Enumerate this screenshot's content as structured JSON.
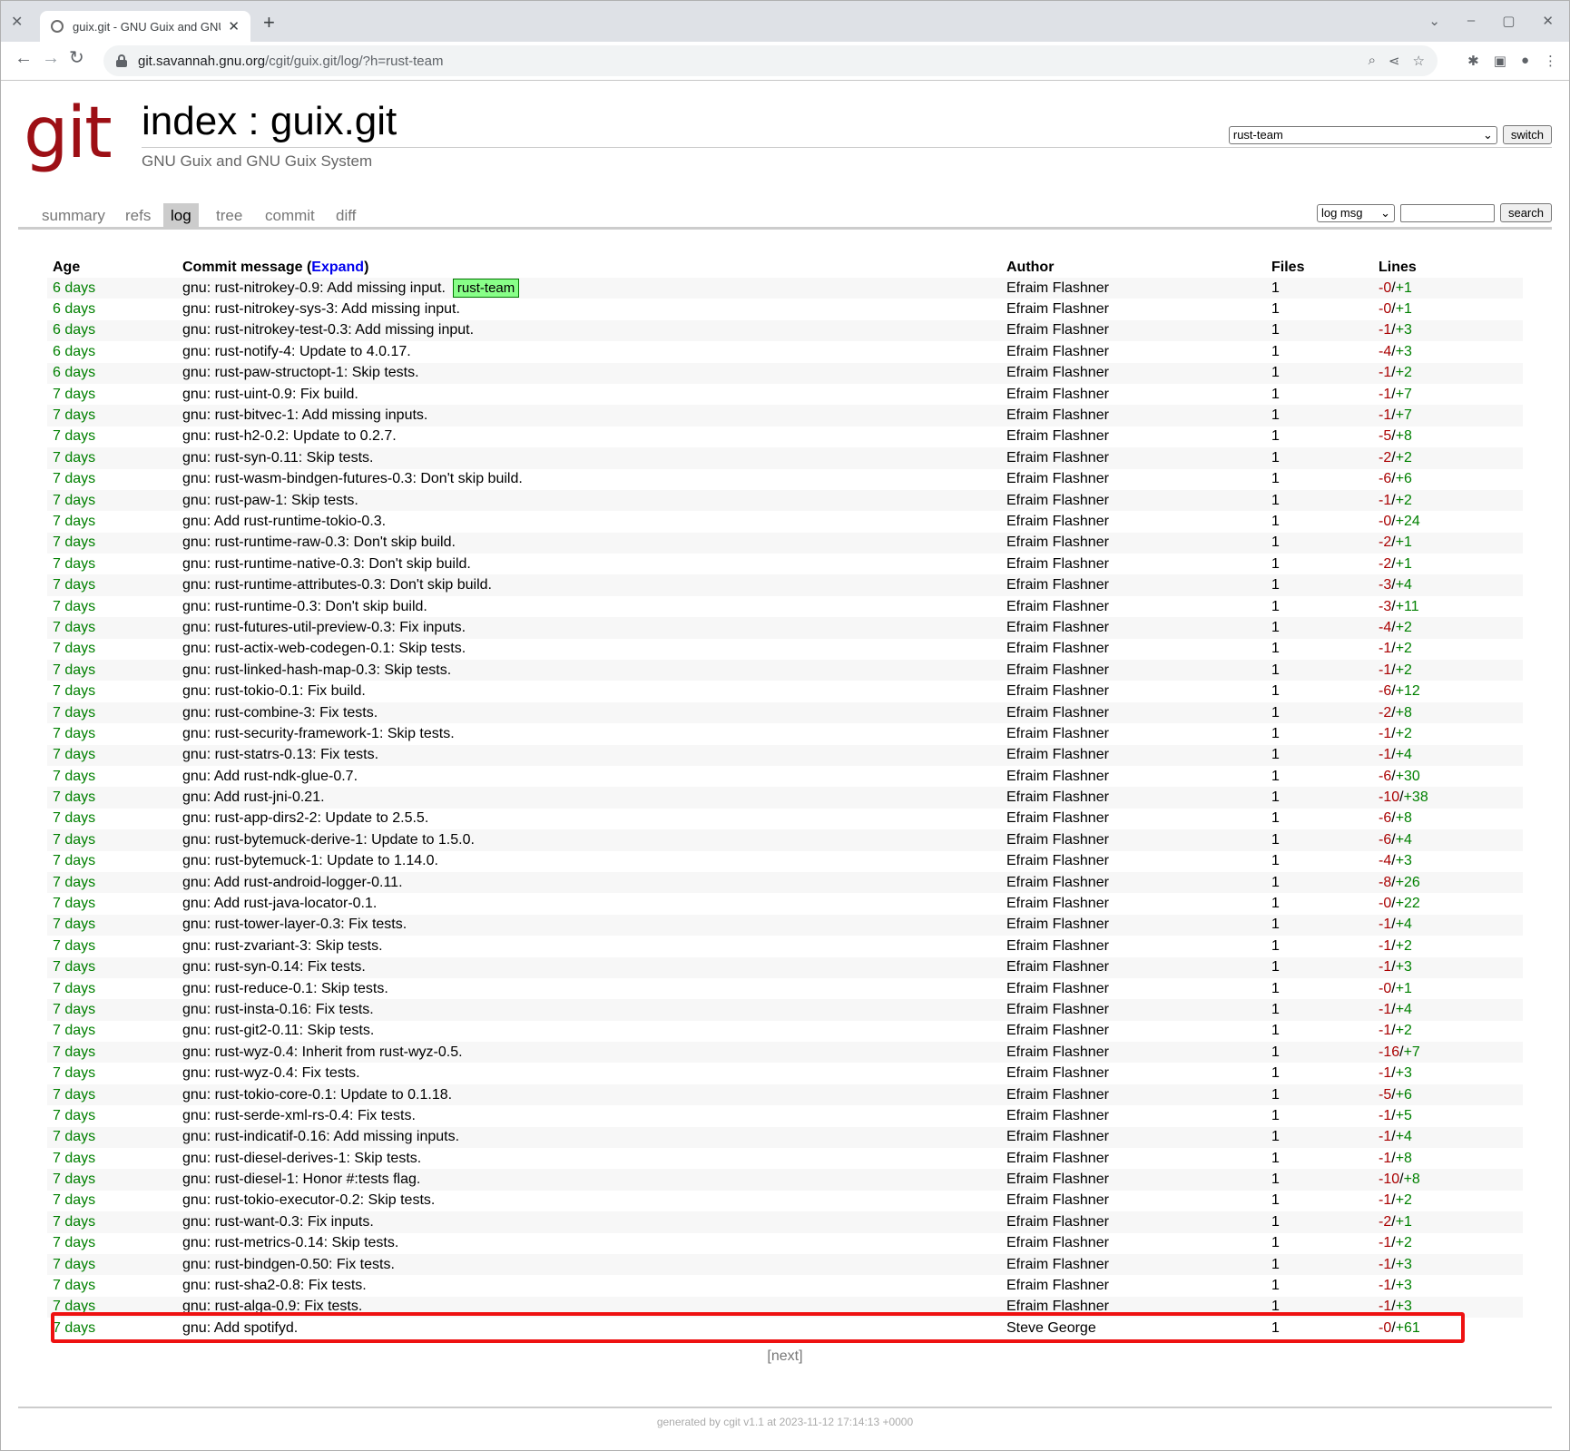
{
  "browser": {
    "tab_title": "guix.git - GNU Guix and GNU G",
    "url_host": "git.savannah.gnu.org",
    "url_path": "/cgit/guix.git/log/?h=rust-team"
  },
  "header": {
    "logo": "git",
    "title": "index : guix.git",
    "subtitle": "GNU Guix and GNU Guix System",
    "branch_selected": "rust-team",
    "switch_label": "switch"
  },
  "nav": {
    "tabs": [
      "summary",
      "refs",
      "log",
      "tree",
      "commit",
      "diff"
    ],
    "active": "log",
    "search_mode": "log msg",
    "search_label": "search"
  },
  "table": {
    "headers": {
      "age": "Age",
      "message_prefix": "Commit message (",
      "expand": "Expand",
      "message_suffix": ")",
      "author": "Author",
      "files": "Files",
      "lines": "Lines"
    },
    "rows": [
      {
        "age": "6 days",
        "msg": "gnu: rust-nitrokey-0.9: Add missing input.",
        "branch": "rust-team",
        "author": "Efraim Flashner",
        "files": "1",
        "del": "-0",
        "add": "+1"
      },
      {
        "age": "6 days",
        "msg": "gnu: rust-nitrokey-sys-3: Add missing input.",
        "author": "Efraim Flashner",
        "files": "1",
        "del": "-0",
        "add": "+1"
      },
      {
        "age": "6 days",
        "msg": "gnu: rust-nitrokey-test-0.3: Add missing input.",
        "author": "Efraim Flashner",
        "files": "1",
        "del": "-1",
        "add": "+3"
      },
      {
        "age": "6 days",
        "msg": "gnu: rust-notify-4: Update to 4.0.17.",
        "author": "Efraim Flashner",
        "files": "1",
        "del": "-4",
        "add": "+3"
      },
      {
        "age": "6 days",
        "msg": "gnu: rust-paw-structopt-1: Skip tests.",
        "author": "Efraim Flashner",
        "files": "1",
        "del": "-1",
        "add": "+2"
      },
      {
        "age": "7 days",
        "msg": "gnu: rust-uint-0.9: Fix build.",
        "author": "Efraim Flashner",
        "files": "1",
        "del": "-1",
        "add": "+7"
      },
      {
        "age": "7 days",
        "msg": "gnu: rust-bitvec-1: Add missing inputs.",
        "author": "Efraim Flashner",
        "files": "1",
        "del": "-1",
        "add": "+7"
      },
      {
        "age": "7 days",
        "msg": "gnu: rust-h2-0.2: Update to 0.2.7.",
        "author": "Efraim Flashner",
        "files": "1",
        "del": "-5",
        "add": "+8"
      },
      {
        "age": "7 days",
        "msg": "gnu: rust-syn-0.11: Skip tests.",
        "author": "Efraim Flashner",
        "files": "1",
        "del": "-2",
        "add": "+2"
      },
      {
        "age": "7 days",
        "msg": "gnu: rust-wasm-bindgen-futures-0.3: Don't skip build.",
        "author": "Efraim Flashner",
        "files": "1",
        "del": "-6",
        "add": "+6"
      },
      {
        "age": "7 days",
        "msg": "gnu: rust-paw-1: Skip tests.",
        "author": "Efraim Flashner",
        "files": "1",
        "del": "-1",
        "add": "+2"
      },
      {
        "age": "7 days",
        "msg": "gnu: Add rust-runtime-tokio-0.3.",
        "author": "Efraim Flashner",
        "files": "1",
        "del": "-0",
        "add": "+24"
      },
      {
        "age": "7 days",
        "msg": "gnu: rust-runtime-raw-0.3: Don't skip build.",
        "author": "Efraim Flashner",
        "files": "1",
        "del": "-2",
        "add": "+1"
      },
      {
        "age": "7 days",
        "msg": "gnu: rust-runtime-native-0.3: Don't skip build.",
        "author": "Efraim Flashner",
        "files": "1",
        "del": "-2",
        "add": "+1"
      },
      {
        "age": "7 days",
        "msg": "gnu: rust-runtime-attributes-0.3: Don't skip build.",
        "author": "Efraim Flashner",
        "files": "1",
        "del": "-3",
        "add": "+4"
      },
      {
        "age": "7 days",
        "msg": "gnu: rust-runtime-0.3: Don't skip build.",
        "author": "Efraim Flashner",
        "files": "1",
        "del": "-3",
        "add": "+11"
      },
      {
        "age": "7 days",
        "msg": "gnu: rust-futures-util-preview-0.3: Fix inputs.",
        "author": "Efraim Flashner",
        "files": "1",
        "del": "-4",
        "add": "+2"
      },
      {
        "age": "7 days",
        "msg": "gnu: rust-actix-web-codegen-0.1: Skip tests.",
        "author": "Efraim Flashner",
        "files": "1",
        "del": "-1",
        "add": "+2"
      },
      {
        "age": "7 days",
        "msg": "gnu: rust-linked-hash-map-0.3: Skip tests.",
        "author": "Efraim Flashner",
        "files": "1",
        "del": "-1",
        "add": "+2"
      },
      {
        "age": "7 days",
        "msg": "gnu: rust-tokio-0.1: Fix build.",
        "author": "Efraim Flashner",
        "files": "1",
        "del": "-6",
        "add": "+12"
      },
      {
        "age": "7 days",
        "msg": "gnu: rust-combine-3: Fix tests.",
        "author": "Efraim Flashner",
        "files": "1",
        "del": "-2",
        "add": "+8"
      },
      {
        "age": "7 days",
        "msg": "gnu: rust-security-framework-1: Skip tests.",
        "author": "Efraim Flashner",
        "files": "1",
        "del": "-1",
        "add": "+2"
      },
      {
        "age": "7 days",
        "msg": "gnu: rust-statrs-0.13: Fix tests.",
        "author": "Efraim Flashner",
        "files": "1",
        "del": "-1",
        "add": "+4"
      },
      {
        "age": "7 days",
        "msg": "gnu: Add rust-ndk-glue-0.7.",
        "author": "Efraim Flashner",
        "files": "1",
        "del": "-6",
        "add": "+30"
      },
      {
        "age": "7 days",
        "msg": "gnu: Add rust-jni-0.21.",
        "author": "Efraim Flashner",
        "files": "1",
        "del": "-10",
        "add": "+38"
      },
      {
        "age": "7 days",
        "msg": "gnu: rust-app-dirs2-2: Update to 2.5.5.",
        "author": "Efraim Flashner",
        "files": "1",
        "del": "-6",
        "add": "+8"
      },
      {
        "age": "7 days",
        "msg": "gnu: rust-bytemuck-derive-1: Update to 1.5.0.",
        "author": "Efraim Flashner",
        "files": "1",
        "del": "-6",
        "add": "+4"
      },
      {
        "age": "7 days",
        "msg": "gnu: rust-bytemuck-1: Update to 1.14.0.",
        "author": "Efraim Flashner",
        "files": "1",
        "del": "-4",
        "add": "+3"
      },
      {
        "age": "7 days",
        "msg": "gnu: Add rust-android-logger-0.11.",
        "author": "Efraim Flashner",
        "files": "1",
        "del": "-8",
        "add": "+26"
      },
      {
        "age": "7 days",
        "msg": "gnu: Add rust-java-locator-0.1.",
        "author": "Efraim Flashner",
        "files": "1",
        "del": "-0",
        "add": "+22"
      },
      {
        "age": "7 days",
        "msg": "gnu: rust-tower-layer-0.3: Fix tests.",
        "author": "Efraim Flashner",
        "files": "1",
        "del": "-1",
        "add": "+4"
      },
      {
        "age": "7 days",
        "msg": "gnu: rust-zvariant-3: Skip tests.",
        "author": "Efraim Flashner",
        "files": "1",
        "del": "-1",
        "add": "+2"
      },
      {
        "age": "7 days",
        "msg": "gnu: rust-syn-0.14: Fix tests.",
        "author": "Efraim Flashner",
        "files": "1",
        "del": "-1",
        "add": "+3"
      },
      {
        "age": "7 days",
        "msg": "gnu: rust-reduce-0.1: Skip tests.",
        "author": "Efraim Flashner",
        "files": "1",
        "del": "-0",
        "add": "+1"
      },
      {
        "age": "7 days",
        "msg": "gnu: rust-insta-0.16: Fix tests.",
        "author": "Efraim Flashner",
        "files": "1",
        "del": "-1",
        "add": "+4"
      },
      {
        "age": "7 days",
        "msg": "gnu: rust-git2-0.11: Skip tests.",
        "author": "Efraim Flashner",
        "files": "1",
        "del": "-1",
        "add": "+2"
      },
      {
        "age": "7 days",
        "msg": "gnu: rust-wyz-0.4: Inherit from rust-wyz-0.5.",
        "author": "Efraim Flashner",
        "files": "1",
        "del": "-16",
        "add": "+7"
      },
      {
        "age": "7 days",
        "msg": "gnu: rust-wyz-0.4: Fix tests.",
        "author": "Efraim Flashner",
        "files": "1",
        "del": "-1",
        "add": "+3"
      },
      {
        "age": "7 days",
        "msg": "gnu: rust-tokio-core-0.1: Update to 0.1.18.",
        "author": "Efraim Flashner",
        "files": "1",
        "del": "-5",
        "add": "+6"
      },
      {
        "age": "7 days",
        "msg": "gnu: rust-serde-xml-rs-0.4: Fix tests.",
        "author": "Efraim Flashner",
        "files": "1",
        "del": "-1",
        "add": "+5"
      },
      {
        "age": "7 days",
        "msg": "gnu: rust-indicatif-0.16: Add missing inputs.",
        "author": "Efraim Flashner",
        "files": "1",
        "del": "-1",
        "add": "+4"
      },
      {
        "age": "7 days",
        "msg": "gnu: rust-diesel-derives-1: Skip tests.",
        "author": "Efraim Flashner",
        "files": "1",
        "del": "-1",
        "add": "+8"
      },
      {
        "age": "7 days",
        "msg": "gnu: rust-diesel-1: Honor #:tests flag.",
        "author": "Efraim Flashner",
        "files": "1",
        "del": "-10",
        "add": "+8"
      },
      {
        "age": "7 days",
        "msg": "gnu: rust-tokio-executor-0.2: Skip tests.",
        "author": "Efraim Flashner",
        "files": "1",
        "del": "-1",
        "add": "+2"
      },
      {
        "age": "7 days",
        "msg": "gnu: rust-want-0.3: Fix inputs.",
        "author": "Efraim Flashner",
        "files": "1",
        "del": "-2",
        "add": "+1"
      },
      {
        "age": "7 days",
        "msg": "gnu: rust-metrics-0.14: Skip tests.",
        "author": "Efraim Flashner",
        "files": "1",
        "del": "-1",
        "add": "+2"
      },
      {
        "age": "7 days",
        "msg": "gnu: rust-bindgen-0.50: Fix tests.",
        "author": "Efraim Flashner",
        "files": "1",
        "del": "-1",
        "add": "+3"
      },
      {
        "age": "7 days",
        "msg": "gnu: rust-sha2-0.8: Fix tests.",
        "author": "Efraim Flashner",
        "files": "1",
        "del": "-1",
        "add": "+3"
      },
      {
        "age": "7 days",
        "msg": "gnu: rust-alga-0.9: Fix tests.",
        "author": "Efraim Flashner",
        "files": "1",
        "del": "-1",
        "add": "+3"
      },
      {
        "age": "7 days",
        "msg": "gnu: Add spotifyd.",
        "author": "Steve George",
        "files": "1",
        "del": "-0",
        "add": "+61"
      }
    ],
    "lines_sep": "/"
  },
  "pager": {
    "next": "[next]"
  },
  "footer": {
    "text": "generated by cgit v1.1 at 2023-11-12 17:14:13 +0000"
  },
  "colors": {
    "logo": "#9d0f15",
    "age": "#008000",
    "del": "#aa0000",
    "add": "#008000",
    "highlight": "#ee1111",
    "branch_deco": "#88ff88"
  }
}
